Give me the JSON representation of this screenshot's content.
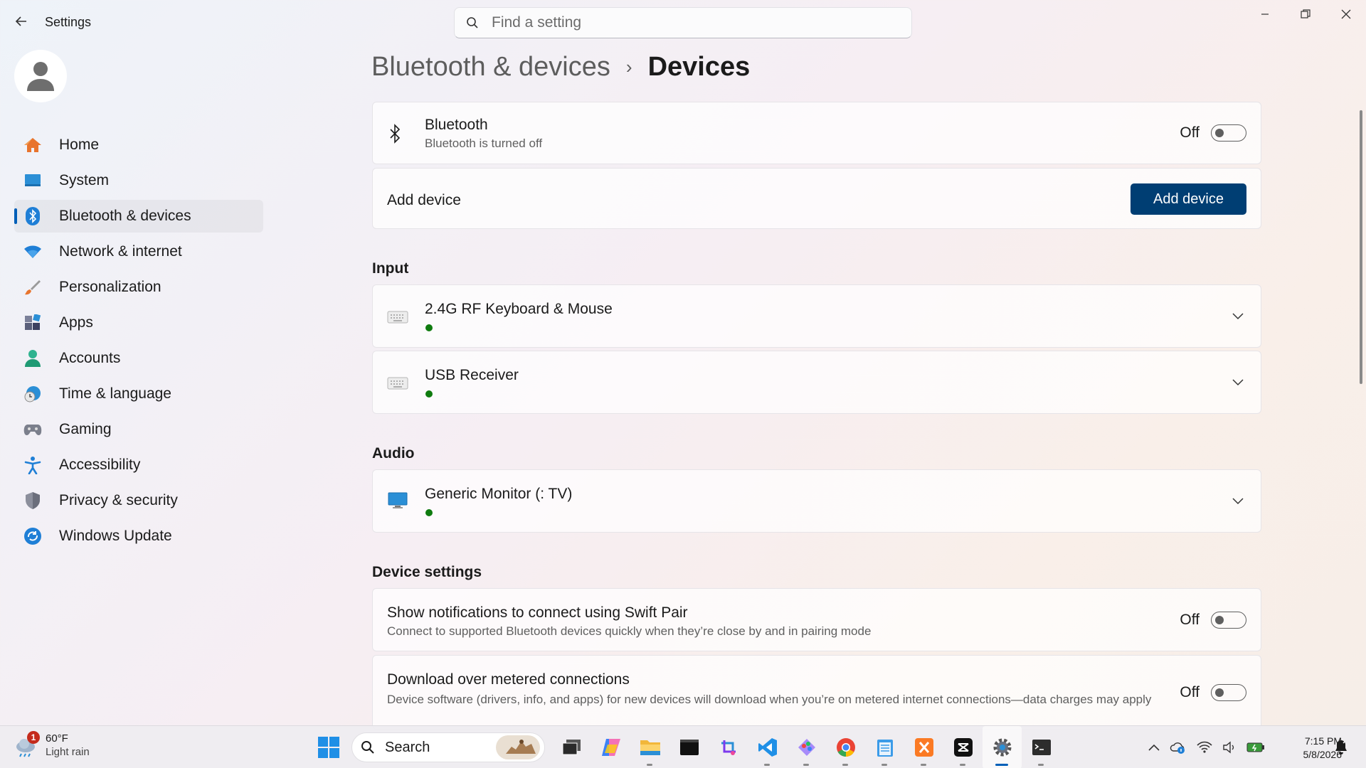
{
  "app": {
    "title": "Settings"
  },
  "search": {
    "placeholder": "Find a setting"
  },
  "sidebar": {
    "items": [
      {
        "label": "Home",
        "icon": "home-icon"
      },
      {
        "label": "System",
        "icon": "system-icon"
      },
      {
        "label": "Bluetooth & devices",
        "icon": "bluetooth-icon",
        "active": true
      },
      {
        "label": "Network & internet",
        "icon": "wifi-icon"
      },
      {
        "label": "Personalization",
        "icon": "brush-icon"
      },
      {
        "label": "Apps",
        "icon": "apps-icon"
      },
      {
        "label": "Accounts",
        "icon": "person-icon"
      },
      {
        "label": "Time & language",
        "icon": "clock-globe-icon"
      },
      {
        "label": "Gaming",
        "icon": "gamepad-icon"
      },
      {
        "label": "Accessibility",
        "icon": "accessibility-icon"
      },
      {
        "label": "Privacy & security",
        "icon": "shield-icon"
      },
      {
        "label": "Windows Update",
        "icon": "update-icon"
      }
    ]
  },
  "breadcrumb": {
    "parent": "Bluetooth & devices",
    "separator": "›",
    "current": "Devices"
  },
  "bluetooth": {
    "title": "Bluetooth",
    "subtitle": "Bluetooth is turned off",
    "state": "Off"
  },
  "add_device": {
    "title": "Add device",
    "button": "Add device"
  },
  "sections": {
    "input": "Input",
    "audio": "Audio",
    "device_settings": "Device settings"
  },
  "input_devices": [
    {
      "name": "2.4G RF Keyboard & Mouse",
      "status": "connected"
    },
    {
      "name": "USB Receiver",
      "status": "connected"
    }
  ],
  "audio_devices": [
    {
      "name": "Generic Monitor (:        TV)",
      "status": "connected"
    }
  ],
  "device_settings": {
    "swift_pair": {
      "title": "Show notifications to connect using Swift Pair",
      "subtitle": "Connect to supported Bluetooth devices quickly when they’re close by and in pairing mode",
      "state": "Off"
    },
    "metered": {
      "title": "Download over metered connections",
      "subtitle": "Device software (drivers, info, and apps) for new devices will download when you’re on metered internet connections—data charges may apply",
      "state": "Off"
    }
  },
  "taskbar": {
    "weather": {
      "temp": "60°F",
      "condition": "Light rain",
      "badge": "1"
    },
    "search_label": "Search",
    "apps": [
      "task-view",
      "copilot",
      "file-explorer",
      "terminal-dark",
      "snipping-tool",
      "vscode",
      "paint-app",
      "chrome",
      "notepad",
      "xampp",
      "capcut",
      "settings",
      "terminal"
    ],
    "clock": {
      "time": "7:15 PM",
      "date": "5/8/2026"
    }
  },
  "colors": {
    "accent": "#005fb8",
    "button": "#003e73",
    "status_ok": "#0f7b0f"
  }
}
